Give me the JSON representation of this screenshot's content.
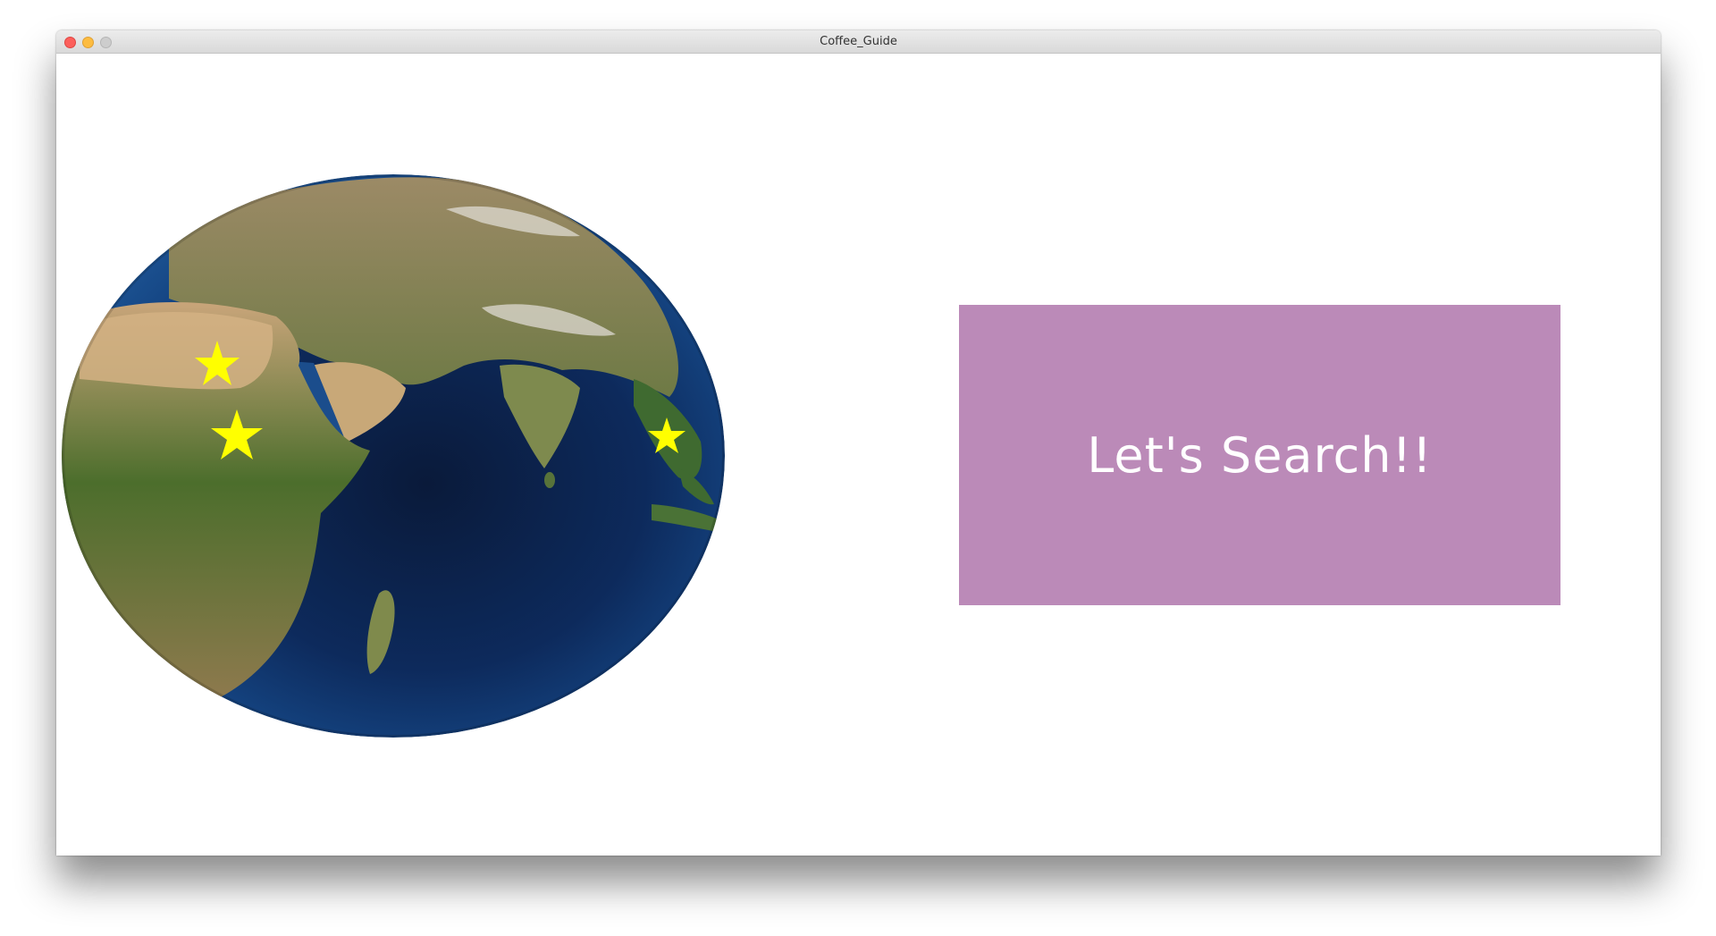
{
  "window": {
    "title": "Coffee_Guide"
  },
  "globe": {
    "icon": "earth-globe",
    "markers": [
      {
        "name": "star-marker",
        "color": "#ffff00"
      },
      {
        "name": "star-marker",
        "color": "#ffff00"
      },
      {
        "name": "star-marker",
        "color": "#ffff00"
      }
    ]
  },
  "search_button": {
    "label": "Let's Search!!",
    "color": "#bb8ab8",
    "text_color": "#ffffff"
  }
}
